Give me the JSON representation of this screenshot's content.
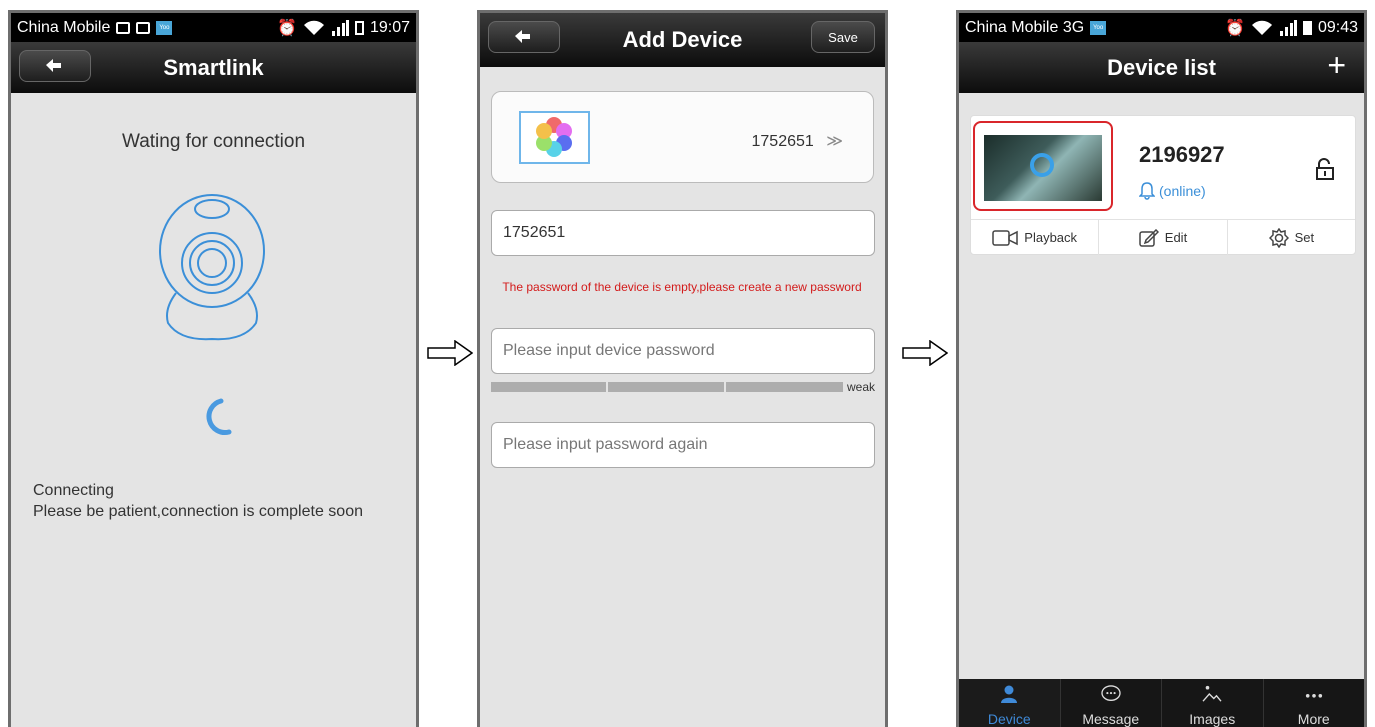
{
  "phone1": {
    "status": {
      "carrier": "China Mobile",
      "time": "19:07"
    },
    "title": "Smartlink",
    "waiting_text": "Wating for connection",
    "connecting_text": "Connecting",
    "patience_text": "Please be patient,connection is complete soon"
  },
  "phone2": {
    "title": "Add Device",
    "save_label": "Save",
    "device_id": "1752651",
    "device_id_chevron": "≫",
    "id_field_value": "1752651",
    "warning": "The password of the device is empty,please create a new password",
    "password_placeholder": "Please input device password",
    "strength_label": "weak",
    "confirm_placeholder": "Please input password again"
  },
  "phone3": {
    "status": {
      "carrier": "China Mobile 3G",
      "time": "09:43"
    },
    "title": "Device list",
    "plus": "+",
    "device": {
      "name": "2196927",
      "status": "(online)"
    },
    "actions": [
      {
        "label": "Playback",
        "icon": "video-icon"
      },
      {
        "label": "Edit",
        "icon": "edit-icon"
      },
      {
        "label": "Set",
        "icon": "settings-icon"
      }
    ],
    "tabs": [
      {
        "label": "Device",
        "icon": "user-icon",
        "active": true
      },
      {
        "label": "Message",
        "icon": "chat-icon",
        "active": false
      },
      {
        "label": "Images",
        "icon": "image-icon",
        "active": false
      },
      {
        "label": "More",
        "icon": "more-icon",
        "active": false
      }
    ]
  },
  "colors": {
    "accent": "#3f8ad8",
    "warning": "#d31b1b",
    "highlight_frame": "#d9262b"
  }
}
